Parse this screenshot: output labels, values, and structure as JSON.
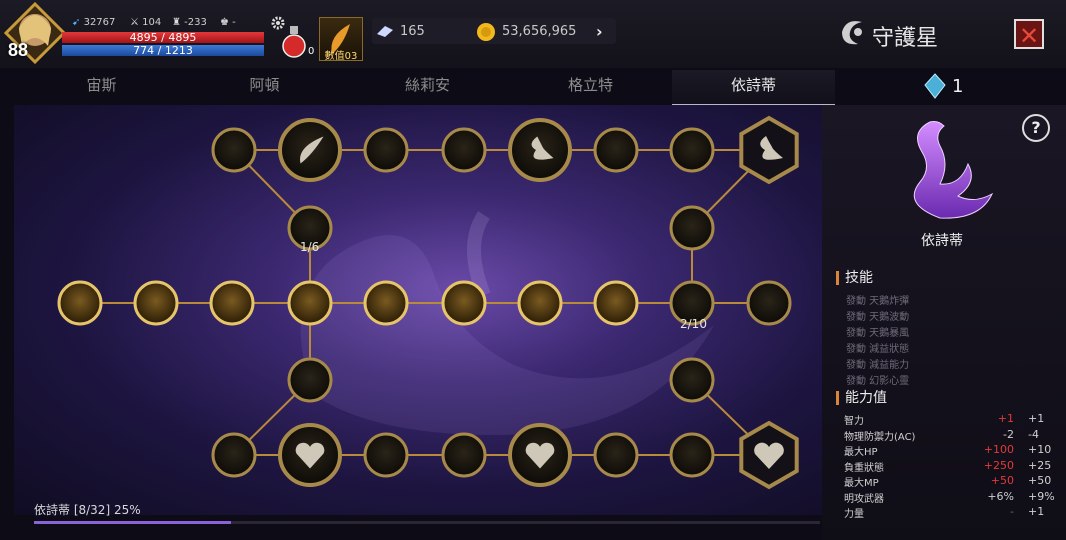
{
  "player": {
    "level": "88",
    "power": "32767",
    "stat2": "104",
    "stat3": "-233",
    "stat4": "-",
    "hp": "4895 / 4895",
    "mp": "774 / 1213"
  },
  "inventory": {
    "potion_count": "0",
    "item_label": "數值03"
  },
  "currency": {
    "gem": "165",
    "gold": "53,656,965"
  },
  "title": "守護星",
  "tabs": [
    {
      "label": "宙斯"
    },
    {
      "label": "阿頓"
    },
    {
      "label": "絲莉安"
    },
    {
      "label": "格立特"
    },
    {
      "label": "依詩蒂"
    }
  ],
  "active_tab": 4,
  "crystal_count": "1",
  "constellation": {
    "name": "依詩蒂",
    "progress_text": "依詩蒂 [8/32] 25%",
    "progress": 0.25,
    "node_labels": {
      "left_branch": "1/6",
      "right_node": "2/10"
    }
  },
  "skills": {
    "title": "技能",
    "items": [
      "發動 天鵝炸彈",
      "發動 天鵝波動",
      "發動 天鵝暴風",
      "發動 減益狀態",
      "發動 減益能力",
      "發動 幻影心靈"
    ]
  },
  "abilities": {
    "title": "能力值",
    "rows": [
      {
        "label": "智力",
        "v1": "+1",
        "v1_color": "#e23a3a",
        "v2": "+1"
      },
      {
        "label": "物理防禦力(AC)",
        "v1": "-2",
        "v1_color": "#d0d0d0",
        "v2": "-4"
      },
      {
        "label": "最大HP",
        "v1": "+100",
        "v1_color": "#e23a3a",
        "v2": "+10"
      },
      {
        "label": "負重狀態",
        "v1": "+250",
        "v1_color": "#e23a3a",
        "v2": "+25"
      },
      {
        "label": "最大MP",
        "v1": "+50",
        "v1_color": "#e23a3a",
        "v2": "+50"
      },
      {
        "label": "明攻武器",
        "v1": "+6%",
        "v1_color": "#d0d0d0",
        "v2": "+9%"
      },
      {
        "label": "力量",
        "v1": "-",
        "v1_color": "#6e6a78",
        "v2": "+1"
      }
    ]
  }
}
